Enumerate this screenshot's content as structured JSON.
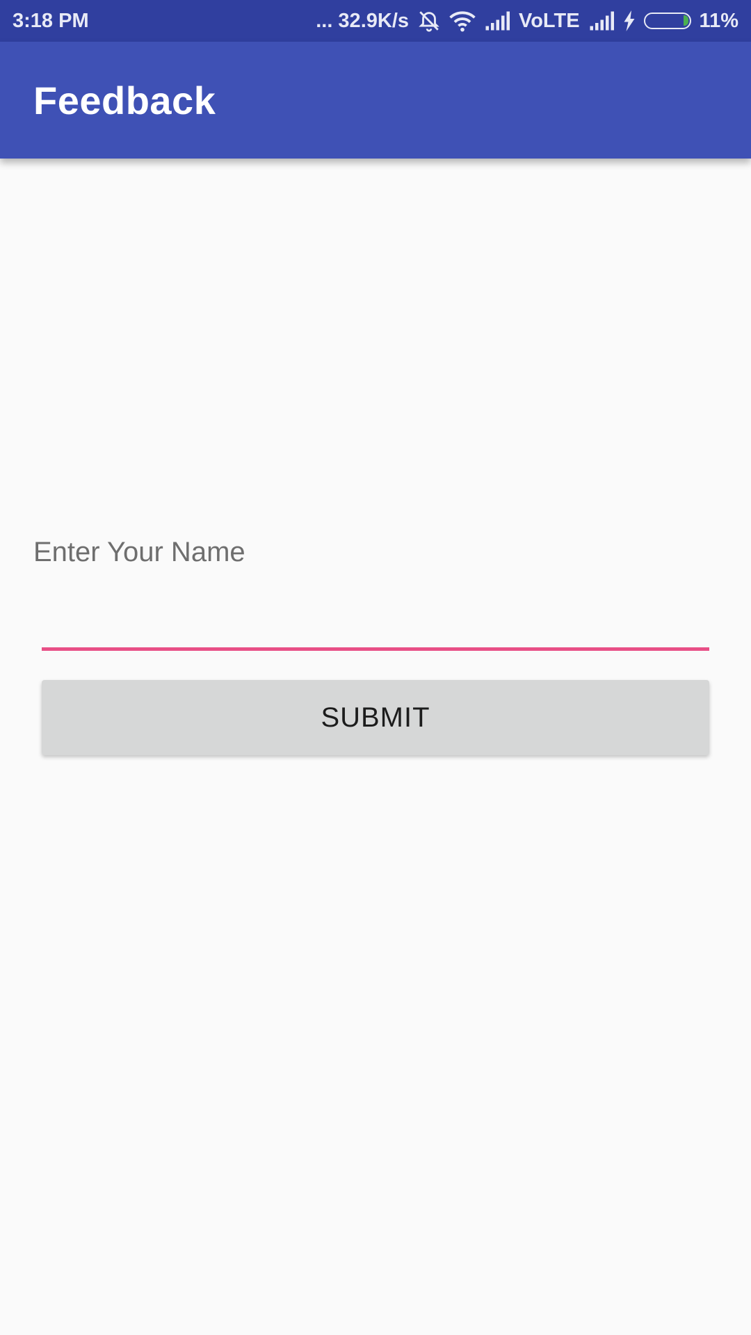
{
  "status_bar": {
    "time": "3:18 PM",
    "network_speed": "... 32.9K/s",
    "network_type": "VoLTE",
    "battery_percent": "11%",
    "battery_level": 0.11,
    "icons": [
      "alarm-off-icon",
      "wifi-icon",
      "signal-icon",
      "signal-icon",
      "charging-icon",
      "battery-icon"
    ],
    "battery_fill_color": "#4caf50"
  },
  "app_bar": {
    "title": "Feedback",
    "color": "#3f51b5"
  },
  "form": {
    "name_label": "Enter Your Name",
    "name_value": "",
    "submit_label": "SUBMIT",
    "accent_color": "#e84f86"
  }
}
